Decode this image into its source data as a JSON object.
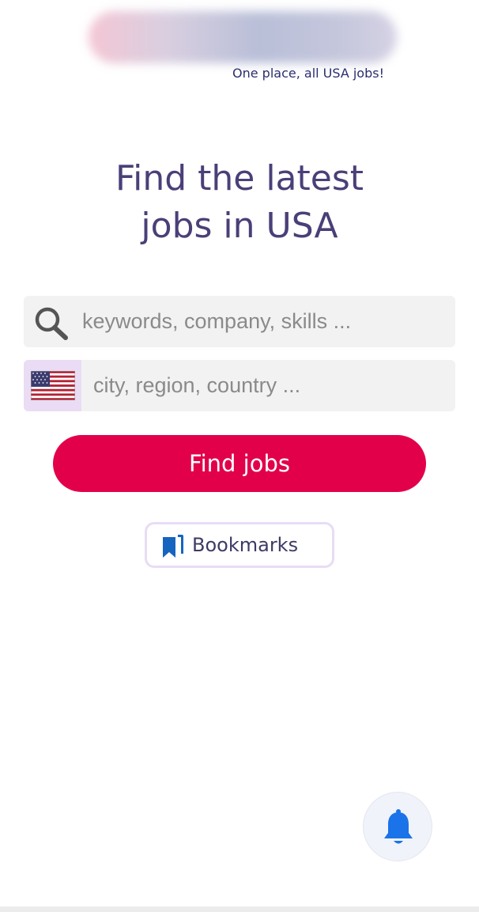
{
  "header": {
    "tagline": "One place, all USA jobs!"
  },
  "hero": {
    "headline_line1": "Find the latest",
    "headline_line2": "jobs in USA"
  },
  "search": {
    "keywords_placeholder": "keywords, company, skills ...",
    "keywords_value": "",
    "location_placeholder": "city, region, country ...",
    "location_value": "",
    "country_flag": "us-flag-icon",
    "find_button_label": "Find jobs"
  },
  "bookmarks": {
    "label": "Bookmarks",
    "icon": "bookmark-icon"
  },
  "alerts": {
    "icon": "bell-icon"
  },
  "colors": {
    "headline": "#4b3f78",
    "primary_button": "#e2004a",
    "bell": "#1a73e8",
    "bookmark": "#1565c0",
    "flag_box": "#e9dcf4"
  }
}
